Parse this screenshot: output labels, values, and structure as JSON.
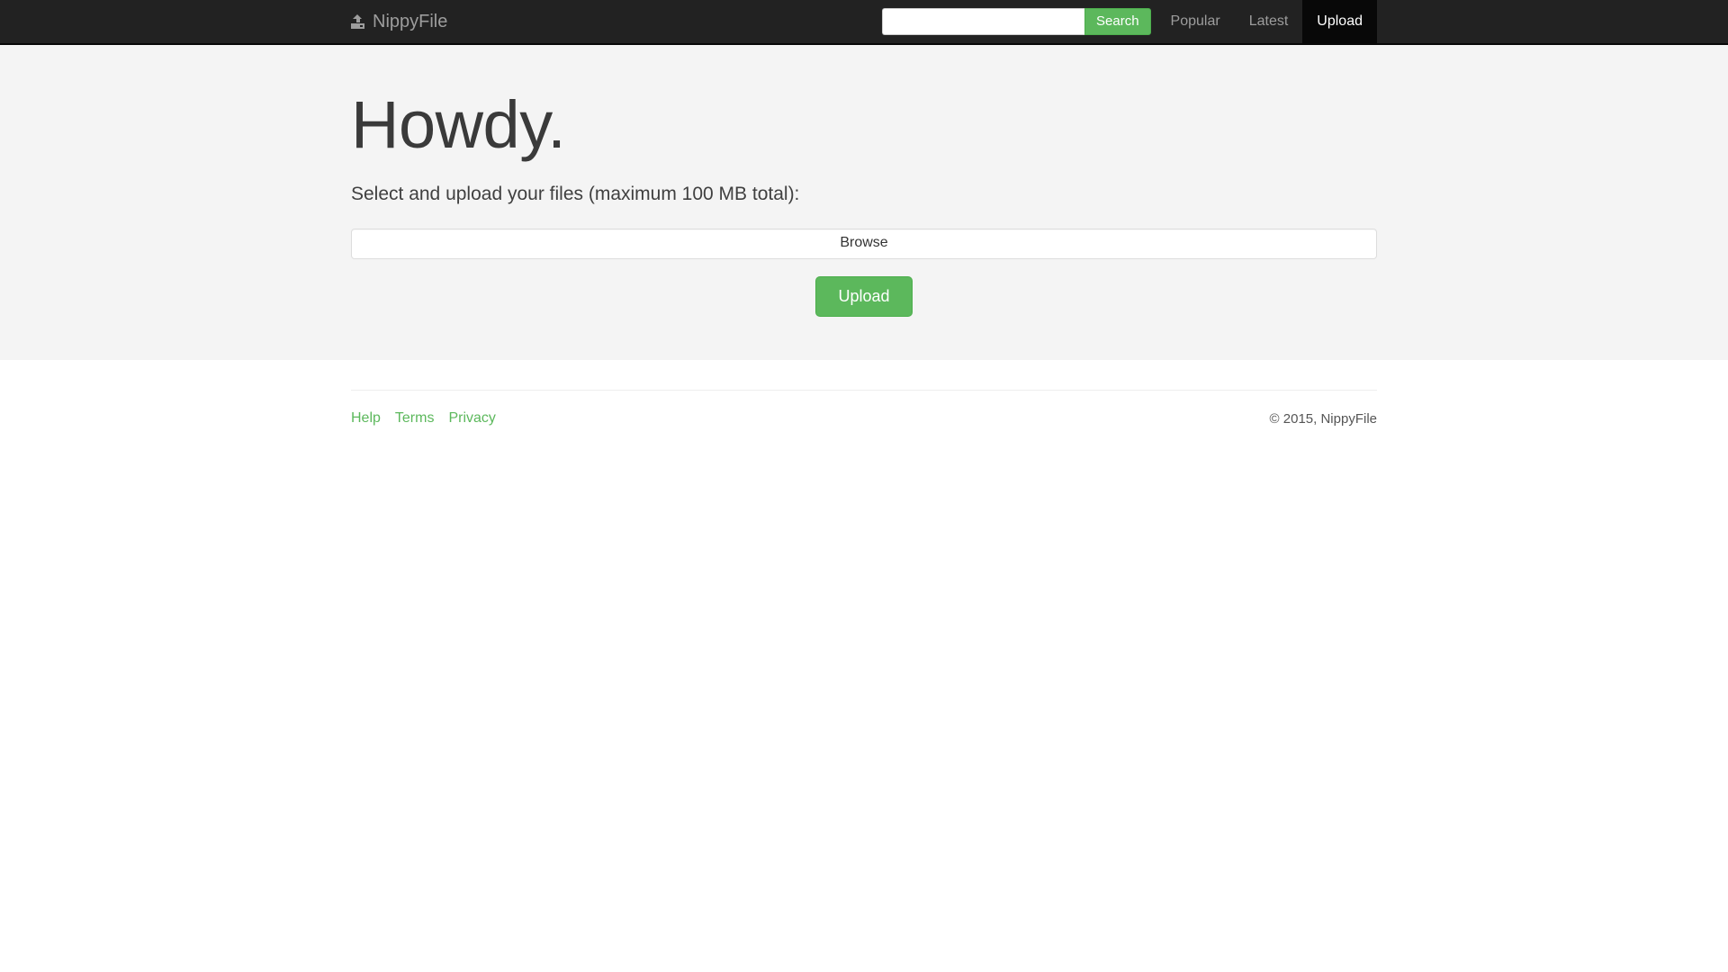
{
  "navbar": {
    "brand": {
      "label": "NippyFile",
      "icon": "upload-icon"
    },
    "search": {
      "value": "",
      "placeholder": "",
      "button_label": "Search"
    },
    "links": [
      {
        "label": "Popular",
        "active": false
      },
      {
        "label": "Latest",
        "active": false
      },
      {
        "label": "Upload",
        "active": true
      }
    ]
  },
  "hero": {
    "title": "Howdy.",
    "subtitle": "Select and upload your files (maximum 100 MB total):",
    "browse_label": "Browse",
    "upload_label": "Upload"
  },
  "footer": {
    "links": [
      {
        "label": "Help"
      },
      {
        "label": "Terms"
      },
      {
        "label": "Privacy"
      }
    ],
    "copyright": "© 2015, NippyFile"
  },
  "colors": {
    "navbar_bg": "#222222",
    "navbar_active_bg": "#080808",
    "navbar_link": "#9d9d9d",
    "brand_green": "#5cb85c",
    "jumbotron_bg": "#f4f4f4",
    "page_bg": "#ffffff"
  }
}
